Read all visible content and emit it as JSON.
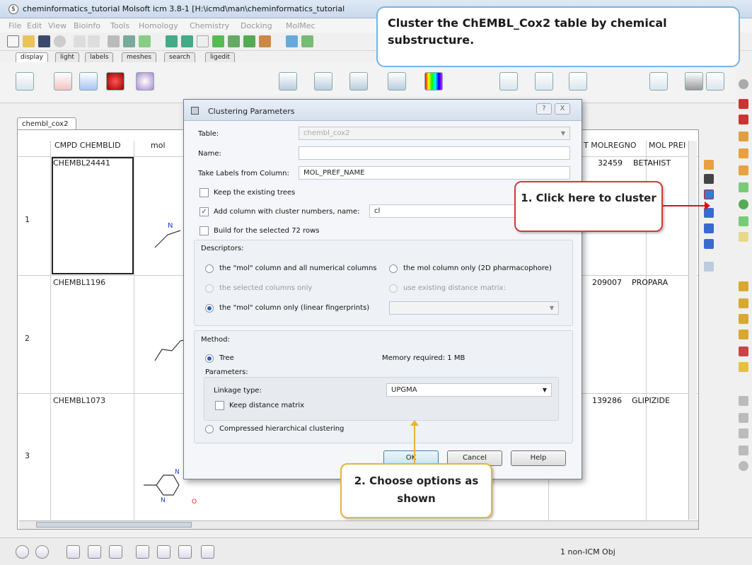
{
  "window": {
    "title": "cheminformatics_tutorial Molsoft icm 3.8-1  [H:\\icmd\\man\\cheminformatics_tutorial"
  },
  "menubar": [
    "File",
    "Edit",
    "View",
    "Bioinfo",
    "Tools",
    "Homology",
    "Chemistry",
    "Docking",
    "MolMec"
  ],
  "panel_tabs": [
    "display",
    "light",
    "labels",
    "meshes",
    "search",
    "ligedit"
  ],
  "table": {
    "tab": "chembl_cox2",
    "columns": [
      "CMPD CHEMBLID",
      "mol",
      "T MOLREGNO",
      "MOL PREI"
    ],
    "rows": [
      {
        "num": "1",
        "id": "CHEMBL24441",
        "molregno": "32459",
        "name": "BETAHIST"
      },
      {
        "num": "2",
        "id": "CHEMBL1196",
        "molregno": "209007",
        "name": "PROPARA"
      },
      {
        "num": "3",
        "id": "CHEMBL1073",
        "molregno": "139286",
        "name": "GLIPIZIDE"
      }
    ]
  },
  "status": {
    "text": "1 non-ICM Obj"
  },
  "dialog": {
    "title": "Clustering Parameters",
    "help_btn": "?",
    "close_btn": "X",
    "table_label": "Table:",
    "table_value": "chembl_cox2",
    "name_label": "Name:",
    "name_value": "",
    "labels_from_label": "Take Labels from Column:",
    "labels_from_value": "MOL_PREF_NAME",
    "keep_trees": "Keep the existing trees",
    "add_column": "Add column with cluster numbers, name:",
    "add_column_value": "cl",
    "build_selected": "Build for the selected 72 rows",
    "descriptors_label": "Descriptors:",
    "desc_mol_numeric": "the \"mol\" column and all numerical columns",
    "desc_mol_2d": "the mol column only (2D pharmacophore)",
    "desc_selected": "the selected columns only",
    "desc_existing": "use existing distance matrix:",
    "desc_linear": "the \"mol\" column only (linear fingerprints)",
    "method_label": "Method:",
    "method_tree": "Tree",
    "memory": "Memory required: 1 MB",
    "parameters_label": "Parameters:",
    "linkage_label": "Linkage type:",
    "linkage_value": "UPGMA",
    "keep_matrix": "Keep distance matrix",
    "method_compressed": "Compressed hierarchical clustering",
    "ok": "OK",
    "cancel": "Cancel",
    "help": "Help"
  },
  "callouts": {
    "top": "Cluster the ChEMBL_Cox2 table by chemical substructure.",
    "click_here": "1. Click here to cluster",
    "choose_options": "2. Choose options as shown"
  }
}
